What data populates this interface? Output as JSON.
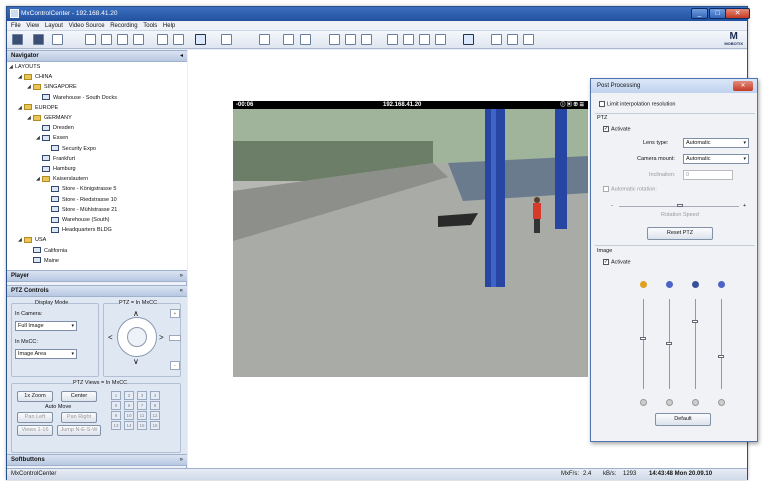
{
  "window": {
    "title": "MxControlCenter - 192.168.41.20",
    "min": "_",
    "max": "□",
    "close": "✕"
  },
  "menu": [
    "File",
    "View",
    "Layout",
    "Video Source",
    "Recording",
    "Tools",
    "Help"
  ],
  "logo": "MOBOTIX",
  "navigator": {
    "title": "Navigator",
    "pin": "◂",
    "items": [
      {
        "label": "LAYOUTS",
        "level": 0,
        "type": "none",
        "arrow": "◢"
      },
      {
        "label": "CHINA",
        "level": 1,
        "type": "folder",
        "arrow": "◢"
      },
      {
        "label": "SINGAPORE",
        "level": 2,
        "type": "folder",
        "arrow": "◢"
      },
      {
        "label": "Warehouse - South Docks",
        "level": 3,
        "type": "layout",
        "arrow": ""
      },
      {
        "label": "EUROPE",
        "level": 1,
        "type": "folder",
        "arrow": "◢"
      },
      {
        "label": "GERMANY",
        "level": 2,
        "type": "folder",
        "arrow": "◢"
      },
      {
        "label": "Dresden",
        "level": 3,
        "type": "monitor",
        "arrow": ""
      },
      {
        "label": "Essen",
        "level": 3,
        "type": "monitor",
        "arrow": "◢"
      },
      {
        "label": "Security Expo",
        "level": 4,
        "type": "monitor",
        "arrow": ""
      },
      {
        "label": "Frankfurt",
        "level": 3,
        "type": "monitor",
        "arrow": ""
      },
      {
        "label": "Hamburg",
        "level": 3,
        "type": "monitor",
        "arrow": ""
      },
      {
        "label": "Kaiserslautern",
        "level": 3,
        "type": "folder",
        "arrow": "◢"
      },
      {
        "label": "Store - Königstrasse 5",
        "level": 4,
        "type": "monitor",
        "arrow": ""
      },
      {
        "label": "Store - Riedstrasse 10",
        "level": 4,
        "type": "monitor",
        "arrow": ""
      },
      {
        "label": "Store - Mühlstrasse 21",
        "level": 4,
        "type": "monitor",
        "arrow": ""
      },
      {
        "label": "Warehouse (South)",
        "level": 4,
        "type": "monitor",
        "arrow": ""
      },
      {
        "label": "Headquarters BLDG",
        "level": 4,
        "type": "monitor",
        "arrow": ""
      },
      {
        "label": "USA",
        "level": 1,
        "type": "folder",
        "arrow": "◢"
      },
      {
        "label": "California",
        "level": 2,
        "type": "monitor",
        "arrow": ""
      },
      {
        "label": "Maine",
        "level": 2,
        "type": "monitor",
        "arrow": ""
      }
    ]
  },
  "player": {
    "title": "Player",
    "pin": "»"
  },
  "ptz": {
    "title": "PTZ Controls",
    "pin": "«",
    "display_mode": "Display Mode",
    "in_camera": "In Camera:",
    "camera_value": "Full Image",
    "in_mxcc": "In MxCC:",
    "mxcc_value": "Image Area",
    "ptz_eq": "PTZ = In MxCC",
    "views_eq": "PTZ Views = In MxCC",
    "btn_zoom": "1x Zoom",
    "btn_center": "Center",
    "auto_move": "Auto Move",
    "btn_pan_left": "Pan Left",
    "btn_pan_right": "Pan Right",
    "btn_views": "Views 1-16",
    "btn_jump": "Jump N-E-S-W",
    "presets": [
      "1",
      "2",
      "3",
      "4",
      "5",
      "6",
      "7",
      "8",
      "9",
      "10",
      "11",
      "12",
      "13",
      "14",
      "15",
      "16"
    ]
  },
  "softbuttons": {
    "title": "Softbuttons",
    "pin": "»"
  },
  "video": {
    "time": "-00:06",
    "ip": "192.168.41.20"
  },
  "statusbar": {
    "app": "MxControlCenter",
    "mxfps_label": "MxF/s:",
    "mxfps": "2.4",
    "kbs_label": "kB/s:",
    "kbs": "1293",
    "datetime": "14:43:48 Mon 20.09.10"
  },
  "post": {
    "title": "Post Processing",
    "close": "✕",
    "limit": "Limit interpolation resolution",
    "ptz_section": "PTZ",
    "activate": "Activate",
    "lens_label": "Lens type:",
    "lens_value": "Automatic",
    "mount_label": "Camera mount:",
    "mount_value": "Automatic",
    "incl_label": "Inclination:",
    "incl_value": "0",
    "auto_rot": "Automatic rotation:",
    "minus": "-",
    "plus": "+",
    "rot_speed": "Rotation Speed",
    "reset": "Reset PTZ",
    "image_section": "Image",
    "image_activate": "Activate",
    "default": "Default",
    "slider_levels": [
      0.42,
      0.48,
      0.23,
      0.62
    ],
    "icon_colors": [
      "#e0a020",
      "#4a64c8",
      "#3a4f9a",
      "#4a64c8"
    ]
  }
}
